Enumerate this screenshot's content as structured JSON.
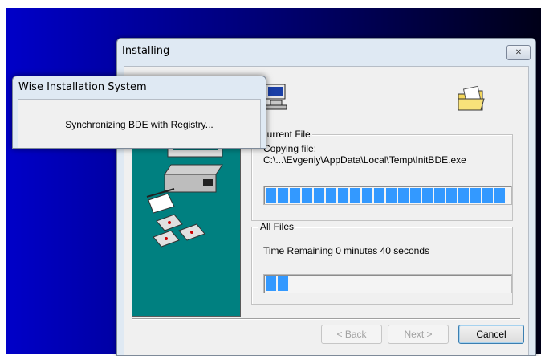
{
  "installer": {
    "title": "Installing",
    "close_glyph": "✕",
    "current_file": {
      "group_label": "Current File",
      "action": "Copying file:",
      "path": "C:\\...\\Evgeniy\\AppData\\Local\\Temp\\InitBDE.exe",
      "progress_percent": 100
    },
    "all_files": {
      "group_label": "All Files",
      "time_remaining": "Time Remaining 0 minutes 40 seconds",
      "progress_percent": 10
    },
    "buttons": {
      "back": "< Back",
      "next": "Next >",
      "cancel": "Cancel"
    }
  },
  "popup": {
    "title": "Wise Installation System",
    "message": "Synchronizing BDE with Registry..."
  },
  "icons": {
    "monitor": "monitor-icon",
    "folder": "open-folder-icon",
    "close": "close-icon"
  },
  "colors": {
    "desktop_start": "#0000c8",
    "desktop_end": "#000018",
    "art_panel": "#008080",
    "progress": "#3399ff"
  }
}
